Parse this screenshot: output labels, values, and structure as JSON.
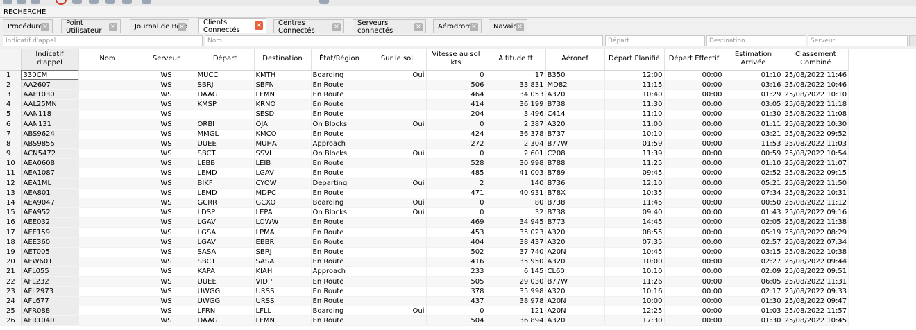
{
  "section": {
    "title": "RECHERCHE"
  },
  "tabs": [
    {
      "label": "Procédures",
      "active": false
    },
    {
      "label": "Point Utilisateur",
      "active": false
    },
    {
      "label": "Journal de Bord",
      "active": false
    },
    {
      "label": "Clients Connectés",
      "active": true
    },
    {
      "label": "Centres Connectés",
      "active": false
    },
    {
      "label": "Serveurs connectés",
      "active": false
    },
    {
      "label": "Aérodrome",
      "active": false
    },
    {
      "label": "Navaids",
      "active": false
    }
  ],
  "filters": {
    "callsign_placeholder": "Indicatif d'appel",
    "name_placeholder": "Nom",
    "departure_placeholder": "Départ",
    "destination_placeholder": "Destination",
    "server_placeholder": "Serveur"
  },
  "columns": {
    "callsign": "Indicatif d'appel",
    "name": "Nom",
    "server": "Serveur",
    "departure": "Départ",
    "destination": "Destination",
    "state": "État/Région",
    "on_ground": "Sur le sol",
    "ground_speed": "Vitesse au sol kts",
    "altitude": "Altitude ft",
    "aircraft": "Aéronef",
    "planned_departure": "Départ Planifié",
    "actual_departure": "Départ Effectif",
    "estimated_arrival": "Estimation Arrivée",
    "combined_rank": "Classement Combiné"
  },
  "rows": [
    [
      "1",
      "330CM",
      "",
      "WS",
      "MUCC",
      "KMTH",
      "Boarding",
      "Oui",
      "0",
      "17",
      "B350",
      "12:00",
      "00:00",
      "01:10",
      "25/08/2022 11:46"
    ],
    [
      "2",
      "AA2607",
      "",
      "WS",
      "SBRJ",
      "SBFN",
      "En Route",
      "",
      "506",
      "33 831",
      "MD82",
      "11:15",
      "00:00",
      "03:16",
      "25/08/2022 10:46"
    ],
    [
      "3",
      "AAF1030",
      "",
      "WS",
      "DAAG",
      "LFMN",
      "En Route",
      "",
      "464",
      "34 053",
      "A320",
      "10:40",
      "00:00",
      "01:29",
      "25/08/2022 10:10"
    ],
    [
      "4",
      "AAL25MN",
      "",
      "WS",
      "KMSP",
      "KRNO",
      "En Route",
      "",
      "414",
      "36 199",
      "B738",
      "11:30",
      "00:00",
      "03:05",
      "25/08/2022 11:18"
    ],
    [
      "5",
      "AAN118",
      "",
      "WS",
      "",
      "SESD",
      "En Route",
      "",
      "204",
      "3 496",
      "C414",
      "11:10",
      "00:00",
      "01:30",
      "25/08/2022 11:08"
    ],
    [
      "6",
      "AAN131",
      "",
      "WS",
      "ORBI",
      "OJAI",
      "On Blocks",
      "Oui",
      "0",
      "2 387",
      "A320",
      "11:00",
      "00:00",
      "01:11",
      "25/08/2022 10:30"
    ],
    [
      "7",
      "ABS9624",
      "",
      "WS",
      "MMGL",
      "KMCO",
      "En Route",
      "",
      "424",
      "36 378",
      "B737",
      "10:10",
      "00:00",
      "03:21",
      "25/08/2022 09:52"
    ],
    [
      "8",
      "ABS9855",
      "",
      "WS",
      "UUEE",
      "MUHA",
      "Approach",
      "",
      "272",
      "2 304",
      "B77W",
      "01:59",
      "00:00",
      "11:53",
      "25/08/2022 11:03"
    ],
    [
      "9",
      "ACN5472",
      "",
      "WS",
      "SBCT",
      "SSVL",
      "On Blocks",
      "Oui",
      "0",
      "2 601",
      "C208",
      "11:39",
      "00:00",
      "00:59",
      "25/08/2022 10:54"
    ],
    [
      "10",
      "AEA0608",
      "",
      "WS",
      "LEBB",
      "LEIB",
      "En Route",
      "",
      "528",
      "30 998",
      "B788",
      "11:25",
      "00:00",
      "01:10",
      "25/08/2022 11:07"
    ],
    [
      "11",
      "AEA1087",
      "",
      "WS",
      "LEMD",
      "LGAV",
      "En Route",
      "",
      "485",
      "41 003",
      "B789",
      "09:45",
      "00:00",
      "02:52",
      "25/08/2022 09:15"
    ],
    [
      "12",
      "AEA1ML",
      "",
      "WS",
      "BIKF",
      "CYOW",
      "Departing",
      "Oui",
      "2",
      "140",
      "B736",
      "12:10",
      "00:00",
      "05:21",
      "25/08/2022 11:50"
    ],
    [
      "13",
      "AEA801",
      "",
      "WS",
      "LEMD",
      "MDPC",
      "En Route",
      "",
      "471",
      "40 931",
      "B78X",
      "10:35",
      "00:00",
      "07:34",
      "25/08/2022 10:31"
    ],
    [
      "14",
      "AEA9047",
      "",
      "WS",
      "GCRR",
      "GCXO",
      "Boarding",
      "Oui",
      "0",
      "80",
      "B738",
      "11:45",
      "00:00",
      "00:50",
      "25/08/2022 11:12"
    ],
    [
      "15",
      "AEA952",
      "",
      "WS",
      "LDSP",
      "LEPA",
      "On Blocks",
      "Oui",
      "0",
      "32",
      "B738",
      "09:40",
      "00:00",
      "01:43",
      "25/08/2022 09:16"
    ],
    [
      "16",
      "AEE032",
      "",
      "WS",
      "LGAV",
      "LOWW",
      "En Route",
      "",
      "469",
      "34 945",
      "B773",
      "14:45",
      "00:00",
      "02:05",
      "25/08/2022 11:38"
    ],
    [
      "17",
      "AEE159",
      "",
      "WS",
      "LGSA",
      "LPMA",
      "En Route",
      "",
      "453",
      "35 023",
      "A320",
      "08:55",
      "00:00",
      "05:19",
      "25/08/2022 08:29"
    ],
    [
      "18",
      "AEE360",
      "",
      "WS",
      "LGAV",
      "EBBR",
      "En Route",
      "",
      "404",
      "38 437",
      "A320",
      "07:35",
      "00:00",
      "02:57",
      "25/08/2022 07:34"
    ],
    [
      "19",
      "AET005",
      "",
      "WS",
      "SASA",
      "SBRJ",
      "En Route",
      "",
      "502",
      "37 740",
      "A20N",
      "10:45",
      "00:00",
      "03:15",
      "25/08/2022 10:38"
    ],
    [
      "20",
      "AEW601",
      "",
      "WS",
      "SBCT",
      "SASA",
      "En Route",
      "",
      "416",
      "35 950",
      "A320",
      "10:00",
      "00:00",
      "02:27",
      "25/08/2022 09:44"
    ],
    [
      "21",
      "AFL055",
      "",
      "WS",
      "KAPA",
      "KIAH",
      "Approach",
      "",
      "233",
      "6 145",
      "CL60",
      "10:10",
      "00:00",
      "02:09",
      "25/08/2022 09:51"
    ],
    [
      "22",
      "AFL232",
      "",
      "WS",
      "UUEE",
      "VIDP",
      "En Route",
      "",
      "505",
      "29 030",
      "B77W",
      "11:26",
      "00:00",
      "06:05",
      "25/08/2022 11:31"
    ],
    [
      "23",
      "AFL2973",
      "",
      "WS",
      "UWGG",
      "URSS",
      "En Route",
      "",
      "378",
      "35 998",
      "A320",
      "10:16",
      "00:00",
      "02:17",
      "25/08/2022 09:33"
    ],
    [
      "24",
      "AFL677",
      "",
      "WS",
      "UWGG",
      "URSS",
      "En Route",
      "",
      "437",
      "38 978",
      "A20N",
      "10:00",
      "00:00",
      "01:30",
      "25/08/2022 09:47"
    ],
    [
      "25",
      "AFR088",
      "",
      "WS",
      "LFRN",
      "LFLL",
      "Boarding",
      "Oui",
      "0",
      "121",
      "A20N",
      "12:25",
      "00:00",
      "01:03",
      "25/08/2022 11:57"
    ],
    [
      "26",
      "AFR1040",
      "",
      "WS",
      "DAAG",
      "LFMN",
      "En Route",
      "",
      "504",
      "36 894",
      "A320",
      "17:30",
      "00:00",
      "01:30",
      "25/08/2022 10:45"
    ]
  ]
}
